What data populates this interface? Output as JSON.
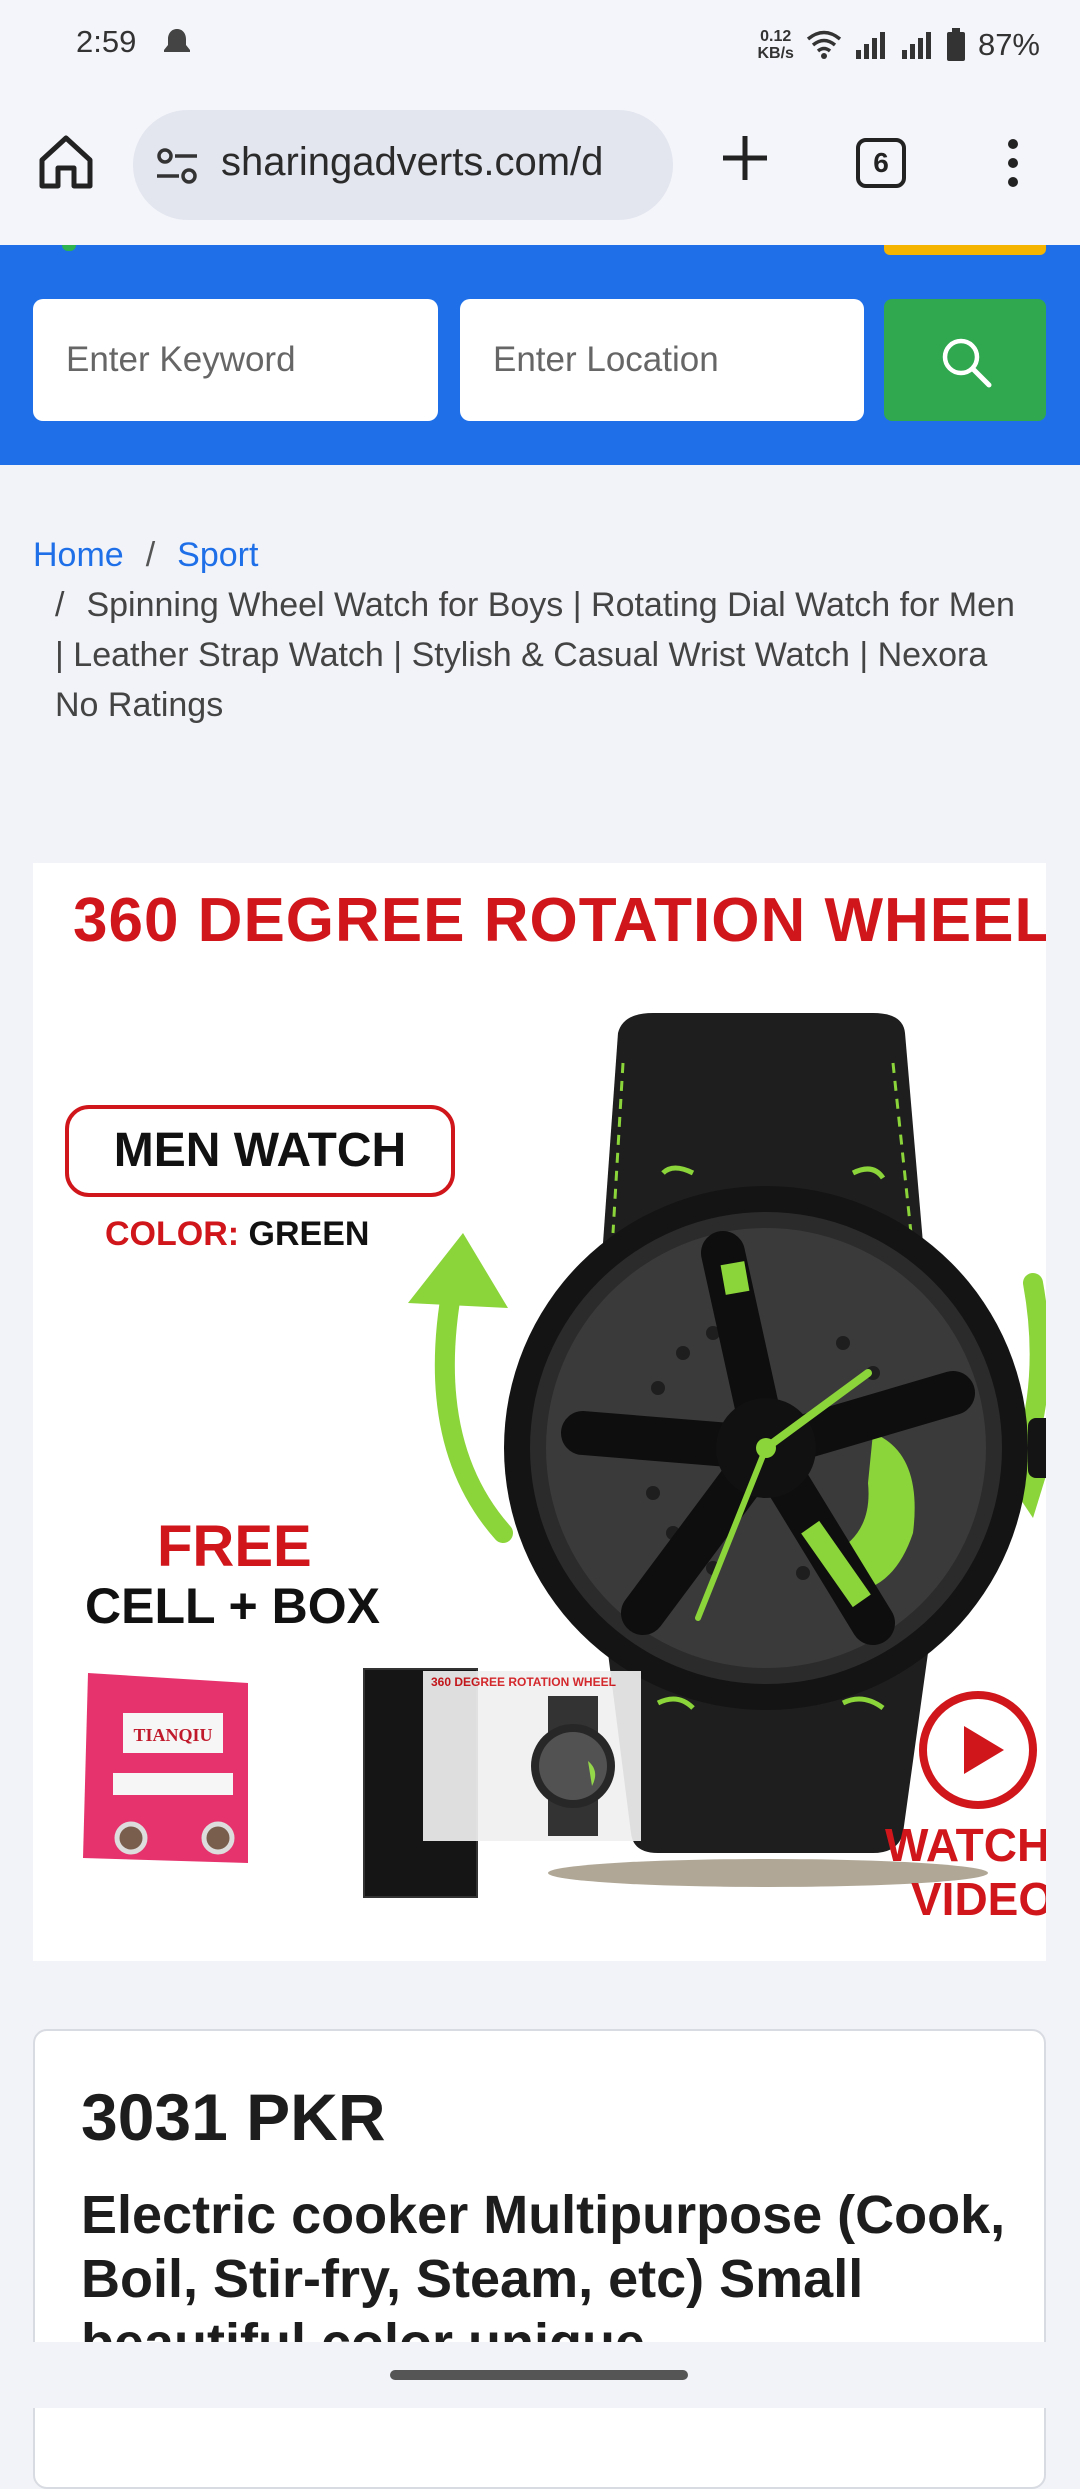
{
  "status": {
    "time": "2:59",
    "net_speed_value": "0.12",
    "net_speed_unit": "KB/s",
    "battery": "87%"
  },
  "browser": {
    "url": "sharingadverts.com/d",
    "tab_count": "6"
  },
  "search": {
    "keyword_placeholder": "Enter Keyword",
    "location_placeholder": "Enter Location"
  },
  "breadcrumb": {
    "home": "Home",
    "separator": "/",
    "category": "Sport",
    "current": "Spinning Wheel Watch for Boys | Rotating Dial Watch for Men | Leather Strap Watch | Stylish & Casual Wrist Watch | Nexora No Ratings"
  },
  "product_image": {
    "headline": "360 DEGREE ROTATION WHEEL",
    "badge": "MEN WATCH",
    "color_label": "COLOR:",
    "color_value": "GREEN",
    "free_label": "FREE",
    "cell_box_label": "CELL + BOX",
    "battery_brand": "TIANQIU",
    "watch_video_line1": "WATCH",
    "watch_video_line2": "VIDEO",
    "accent_green": "#8bd43a",
    "accent_red": "#d0161b"
  },
  "listing": {
    "price": "3031 PKR",
    "title": "Electric cooker Multipurpose (Cook, Boil, Stir-fry, Steam, etc) Small beautiful color unique"
  },
  "colors": {
    "brand_blue": "#1f70e8",
    "search_green": "#2fa84f"
  }
}
